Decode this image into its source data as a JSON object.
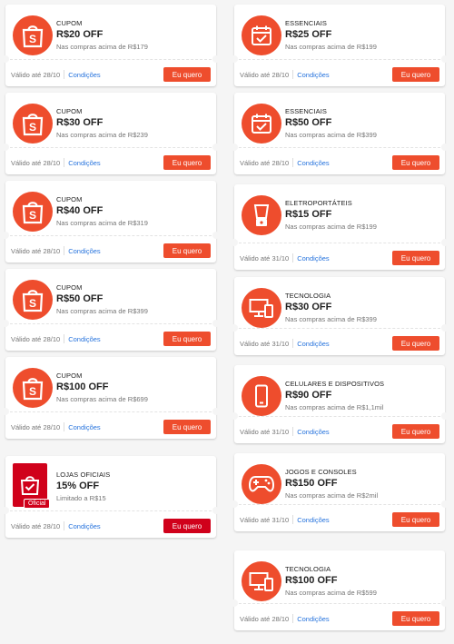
{
  "colors": {
    "accent": "#ee4d2d",
    "official": "#d0011b",
    "link": "#2673dd"
  },
  "left": [
    {
      "icon": "shopping-bag-icon",
      "category": "CUPOM",
      "amount": "R$20 OFF",
      "condition": "Nas compras acima de R$179",
      "valid": "Válido até 28/10",
      "link": "Condições",
      "button": "Eu quero"
    },
    {
      "icon": "shopping-bag-icon",
      "category": "CUPOM",
      "amount": "R$30 OFF",
      "condition": "Nas compras acima de R$239",
      "valid": "Válido até 28/10",
      "link": "Condições",
      "button": "Eu quero"
    },
    {
      "icon": "shopping-bag-icon",
      "category": "CUPOM",
      "amount": "R$40 OFF",
      "condition": "Nas compras acima de R$319",
      "valid": "Válido até 28/10",
      "link": "Condições",
      "button": "Eu quero"
    },
    {
      "icon": "shopping-bag-icon",
      "category": "CUPOM",
      "amount": "R$50 OFF",
      "condition": "Nas compras acima de R$399",
      "valid": "Válido até 28/10",
      "link": "Condições",
      "button": "Eu quero"
    },
    {
      "icon": "shopping-bag-icon",
      "category": "CUPOM",
      "amount": "R$100 OFF",
      "condition": "Nas compras acima de R$699",
      "valid": "Válido até 28/10",
      "link": "Condições",
      "button": "Eu quero"
    },
    {
      "icon": "official-store-icon",
      "badge": "Oficial",
      "category": "LOJAS OFICIAIS",
      "amount": "15% OFF",
      "condition": "Limitado a R$15",
      "valid": "Válido até 28/10",
      "link": "Condições",
      "button": "Eu quero"
    }
  ],
  "right": [
    {
      "icon": "calendar-check-icon",
      "category": "ESSENCIAIS",
      "amount": "R$25 OFF",
      "condition": "Nas compras acima de R$199",
      "valid": "Válido até 28/10",
      "link": "Condições",
      "button": "Eu quero"
    },
    {
      "icon": "calendar-check-icon",
      "category": "ESSENCIAIS",
      "amount": "R$50 OFF",
      "condition": "Nas compras acima de R$399",
      "valid": "Válido até 28/10",
      "link": "Condições",
      "button": "Eu quero"
    },
    {
      "icon": "blender-icon",
      "category": "ELETROPORTÁTEIS",
      "amount": "R$15 OFF",
      "condition": "Nas compras acima de R$199",
      "valid": "Válido até 31/10",
      "link": "Condições",
      "button": "Eu quero"
    },
    {
      "icon": "devices-icon",
      "category": "TECNOLOGIA",
      "amount": "R$30 OFF",
      "condition": "Nas compras acima de R$399",
      "valid": "Válido até 31/10",
      "link": "Condições",
      "button": "Eu quero"
    },
    {
      "icon": "smartphone-icon",
      "category": "CELULARES E DISPOSITIVOS",
      "amount": "R$90 OFF",
      "condition": "Nas compras acima de R$1,1mil",
      "valid": "Válido até 31/10",
      "link": "Condições",
      "button": "Eu quero"
    },
    {
      "icon": "gamepad-icon",
      "category": "JOGOS E CONSOLES",
      "amount": "R$150 OFF",
      "condition": "Nas compras acima de R$2mil",
      "valid": "Válido até 31/10",
      "link": "Condições",
      "button": "Eu quero"
    },
    {
      "icon": "devices-icon",
      "category": "TECNOLOGIA",
      "amount": "R$100 OFF",
      "condition": "Nas compras acima de R$599",
      "valid": "Válido até 28/10",
      "link": "Condições",
      "button": "Eu quero"
    }
  ]
}
